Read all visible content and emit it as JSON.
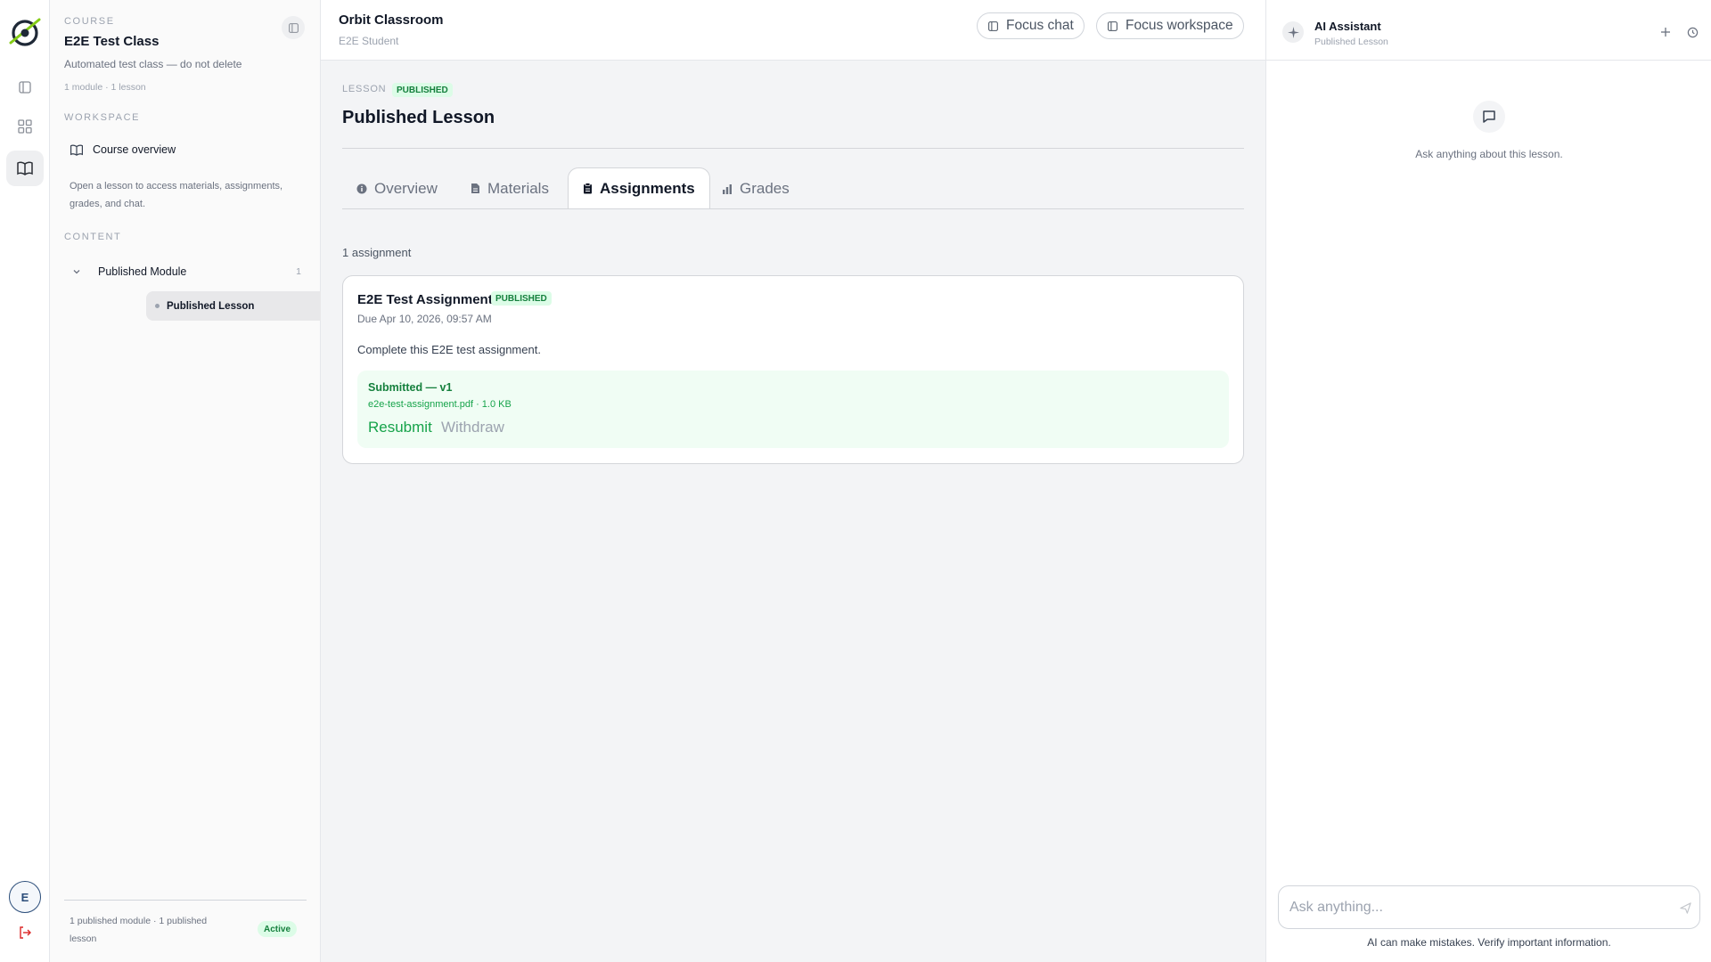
{
  "rail": {
    "avatar_initial": "E"
  },
  "sidebar": {
    "course_eyebrow": "COURSE",
    "course_title": "E2E Test Class",
    "course_description": "Automated test class — do not delete",
    "course_meta": "1 module · 1 lesson",
    "workspace_eyebrow": "WORKSPACE",
    "course_overview_label": "Course overview",
    "help_text": "Open a lesson to access materials, assignments, grades, and chat.",
    "content_eyebrow": "CONTENT",
    "module": {
      "name": "Published Module",
      "count": "1"
    },
    "lesson": {
      "name": "Published Lesson"
    },
    "footer_text": "1 published module · 1 published lesson",
    "footer_status": "Active"
  },
  "header": {
    "app_title": "Orbit Classroom",
    "user_role": "E2E Student",
    "focus_chat_label": "Focus chat",
    "focus_workspace_label": "Focus workspace"
  },
  "lesson": {
    "eyebrow": "LESSON",
    "status": "PUBLISHED",
    "title": "Published Lesson"
  },
  "tabs": [
    {
      "label": "Overview",
      "icon": "info-icon",
      "active": false
    },
    {
      "label": "Materials",
      "icon": "document-icon",
      "active": false
    },
    {
      "label": "Assignments",
      "icon": "clipboard-icon",
      "active": true
    },
    {
      "label": "Grades",
      "icon": "bar-chart-icon",
      "active": false
    }
  ],
  "assignments": {
    "count_text": "1 assignment",
    "items": [
      {
        "title": "E2E Test Assignment",
        "status": "PUBLISHED",
        "due": "Due Apr 10, 2026, 09:57 AM",
        "description": "Complete this E2E test assignment.",
        "submission": {
          "title": "Submitted — v1",
          "file": "e2e-test-assignment.pdf · 1.0 KB",
          "resubmit_label": "Resubmit",
          "withdraw_label": "Withdraw"
        }
      }
    ]
  },
  "ai_panel": {
    "title": "AI Assistant",
    "subtitle": "Published Lesson",
    "empty_text": "Ask anything about this lesson.",
    "input_placeholder": "Ask anything...",
    "disclaimer": "AI can make mistakes. Verify important information."
  },
  "colors": {
    "accent_green": "#16a34a",
    "badge_green_bg": "#dcfce7",
    "logout_red": "#dc2626"
  }
}
